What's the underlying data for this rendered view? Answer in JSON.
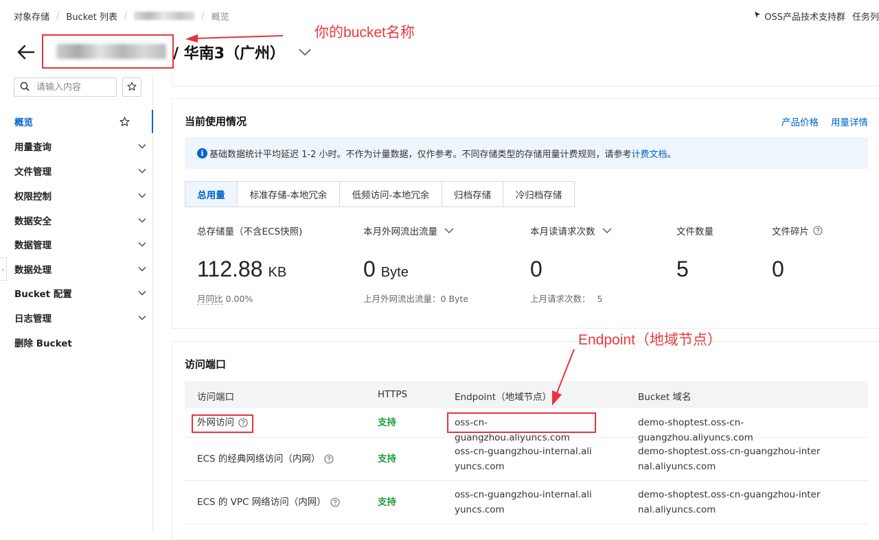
{
  "breadcrumb": {
    "items": [
      "对象存储",
      "Bucket 列表",
      "",
      "概览"
    ]
  },
  "top_right": {
    "support_group": "OSS产品技术支持群",
    "task": "任务列"
  },
  "header": {
    "region": "/ 华南3（广州）"
  },
  "annotations": {
    "bucket_name_note": "你的bucket名称",
    "endpoint_note": "Endpoint（地域节点）"
  },
  "sidebar": {
    "search_placeholder": "请输入内容",
    "items": [
      {
        "label": "概览",
        "active": true,
        "type": "star"
      },
      {
        "label": "用量查询",
        "type": "chevron"
      },
      {
        "label": "文件管理",
        "type": "chevron"
      },
      {
        "label": "权限控制",
        "type": "chevron"
      },
      {
        "label": "数据安全",
        "type": "chevron"
      },
      {
        "label": "数据管理",
        "type": "chevron"
      },
      {
        "label": "数据处理",
        "type": "chevron"
      },
      {
        "label": "Bucket 配置",
        "type": "chevron"
      },
      {
        "label": "日志管理",
        "type": "chevron"
      },
      {
        "label": "删除 Bucket",
        "type": "none"
      }
    ]
  },
  "usage": {
    "title": "当前使用情况",
    "link_price": "产品价格",
    "link_detail": "用量详情",
    "notice_text": "基础数据统计平均延迟 1-2 小时。不作为计量数据，仅作参考。不同存储类型的存储用量计费规则，请参考",
    "notice_link": "计费文档",
    "notice_end": "。",
    "tabs": [
      "总用量",
      "标准存储-本地冗余",
      "低频访问-本地冗余",
      "归档存储",
      "冷归档存储"
    ],
    "metrics": [
      {
        "label": "总存储量（不含ECS快照)",
        "value": "112.88",
        "unit": "KB",
        "sub_label": "月同比",
        "sub_value": "0.00%"
      },
      {
        "label": "本月外网流出流量",
        "value": "0",
        "unit": "Byte",
        "sub_label": "上月外网流出流量：",
        "sub_value": "0 Byte"
      },
      {
        "label": "本月读请求次数",
        "value": "0",
        "unit": "",
        "sub_label": "上月请求次数：",
        "sub_value": "5"
      },
      {
        "label": "文件数量",
        "value": "5",
        "unit": "",
        "sub_label": "",
        "sub_value": ""
      },
      {
        "label": "文件碎片",
        "value": "0",
        "unit": "",
        "sub_label": "",
        "sub_value": ""
      }
    ]
  },
  "endpoints": {
    "title": "访问端口",
    "columns": [
      "访问端口",
      "HTTPS",
      "Endpoint（地域节点）",
      "Bucket 域名"
    ],
    "rows": [
      {
        "name": "外网访问",
        "https": "支持",
        "endpoint": "oss-cn-guangzhou.aliyuncs.com",
        "domain": "demo-shoptest.oss-cn-guangzhou.aliyuncs.com"
      },
      {
        "name": "ECS 的经典网络访问（内网）",
        "https": "支持",
        "endpoint": "oss-cn-guangzhou-internal.aliyuncs.com",
        "domain": "demo-shoptest.oss-cn-guangzhou-internal.aliyuncs.com"
      },
      {
        "name": "ECS 的 VPC 网络访问（内网）",
        "https": "支持",
        "endpoint": "oss-cn-guangzhou-internal.aliyuncs.com",
        "domain": "demo-shoptest.oss-cn-guangzhou-internal.aliyuncs.com"
      }
    ]
  },
  "colors": {
    "accent": "#0064c8",
    "support": "#1f9d3a",
    "annotation": "#e8323c"
  }
}
